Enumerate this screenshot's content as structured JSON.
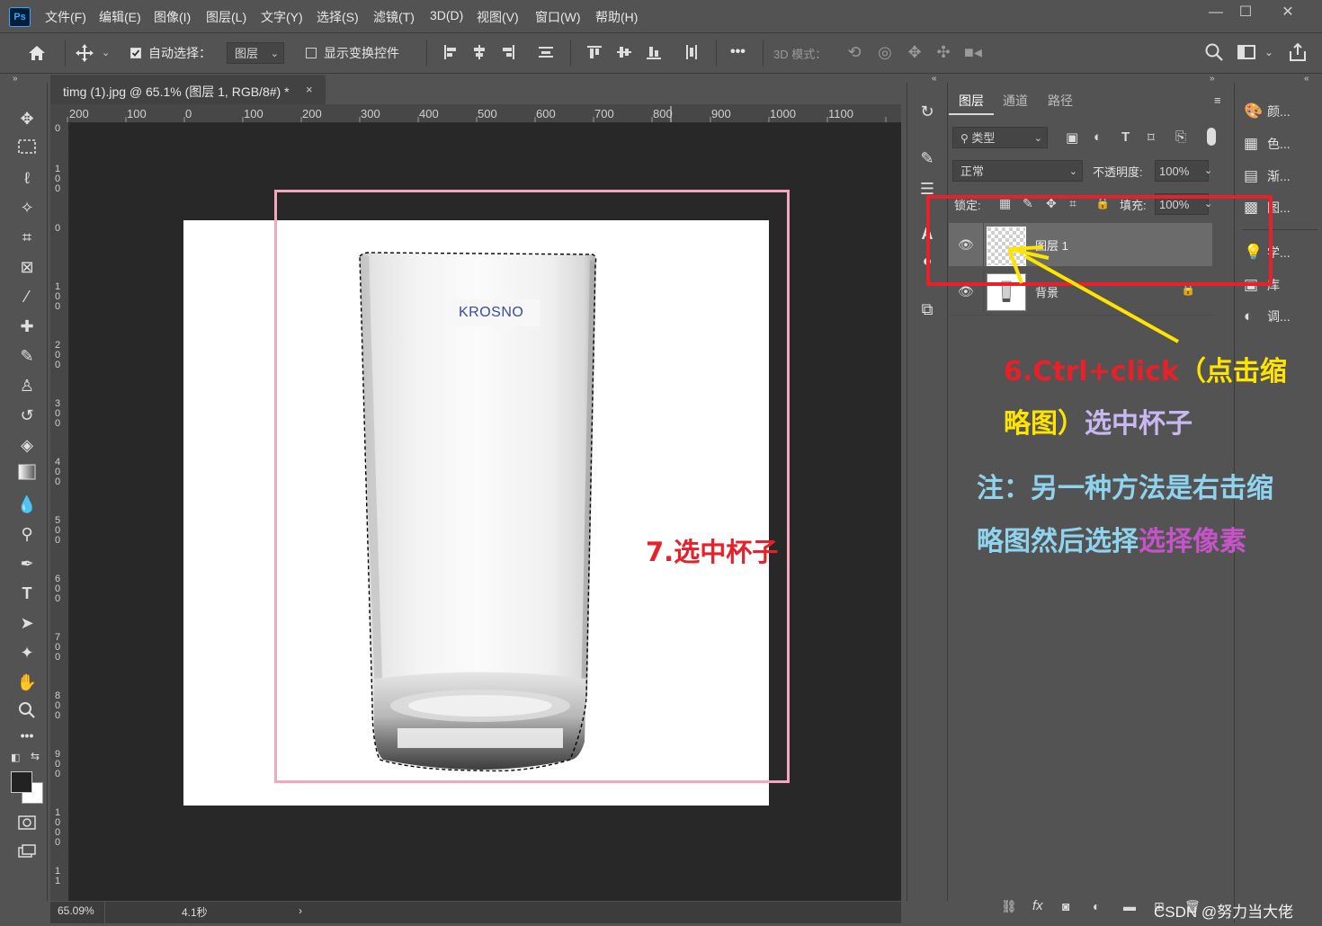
{
  "app": {
    "logo_text": "Ps",
    "menu": [
      "文件(F)",
      "编辑(E)",
      "图像(I)",
      "图层(L)",
      "文字(Y)",
      "选择(S)",
      "滤镜(T)",
      "3D(D)",
      "视图(V)",
      "窗口(W)",
      "帮助(H)"
    ],
    "window_controls": {
      "minimize": "—",
      "maximize": "☐",
      "close": "✕"
    }
  },
  "options_bar": {
    "auto_select_label": "自动选择：",
    "auto_select_target": "图层",
    "show_transform_label": "显示变换控件",
    "mode_3d_label": "3D 模式：",
    "more_label": "•••"
  },
  "document": {
    "tab_title": "timg (1).jpg @ 65.1% (图层 1, RGB/8#) *",
    "close": "×",
    "zoom": "65.09%",
    "timing": "4.1秒",
    "brand_label": "KROSNO"
  },
  "rulers": {
    "top": [
      "200",
      "100",
      "0",
      "100",
      "200",
      "300",
      "400",
      "500",
      "600",
      "700",
      "800",
      "900",
      "1000",
      "1100"
    ],
    "left": [
      "0",
      "1\n0\n0",
      "0",
      "1\n0\n0",
      "2\n0\n0",
      "3\n0\n0",
      "4\n0\n0",
      "5\n0\n0",
      "6\n0\n0",
      "7\n0\n0",
      "8\n0\n0",
      "9\n0\n0",
      "1\n0\n0\n0",
      "1\n1"
    ]
  },
  "layers_panel": {
    "tabs": [
      "图层",
      "通道",
      "路径"
    ],
    "filter_kind": "类型",
    "blend_mode": "正常",
    "opacity_label": "不透明度:",
    "opacity_value": "100%",
    "lock_label": "锁定:",
    "fill_label": "填充:",
    "fill_value": "100%",
    "layers": [
      {
        "name": "图层 1",
        "selected": true
      },
      {
        "name": "背景",
        "locked": true
      }
    ],
    "footer_icons": [
      "link-icon",
      "fx-icon",
      "mask-icon",
      "adjustment-icon",
      "group-icon",
      "new-layer-icon",
      "trash-icon"
    ],
    "fx_label": "fx"
  },
  "right_panel": {
    "items": [
      "颜...",
      "色...",
      "渐...",
      "图...",
      "学...",
      "库",
      "调..."
    ]
  },
  "annotations": {
    "step6_line1_red": "6.Ctrl+click",
    "step6_line1_yellow": "（点击缩",
    "step6_line2_yellow": "略图）",
    "step6_line2_purple": "选中杯子",
    "note_line1": "注：另一种方法是右击缩",
    "note_line2_blue": "略图然后选择",
    "note_line2_magenta": "选择像素",
    "step7": "7.选中杯子",
    "watermark": "CSDN @努力当大佬"
  },
  "colors": {
    "red": "#e8202a",
    "yellow": "#ffe400",
    "lavender": "#c9b8f0",
    "light_blue": "#8fd3ee",
    "magenta": "#c653c8",
    "pink_frame": "#f4a7bd",
    "red_frame": "#e8202a"
  }
}
